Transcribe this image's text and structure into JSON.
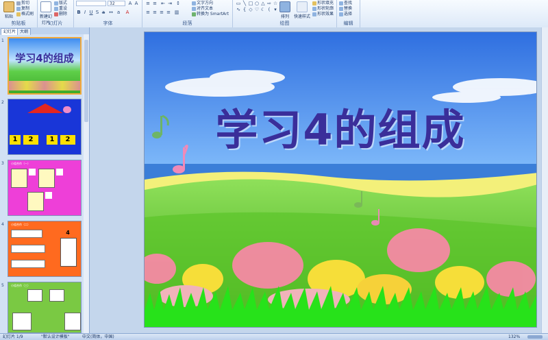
{
  "ribbon": {
    "groups": {
      "clipboard": "剪贴板",
      "slides": "幻灯片",
      "font": "字体",
      "paragraph": "段落",
      "drawing": "绘图",
      "editing": "编辑"
    },
    "paste": "粘贴",
    "cut": "剪切",
    "copy": "复制",
    "format_painter": "格式刷",
    "new_slide": "新建幻灯片",
    "layout": "版式",
    "reset": "重设",
    "delete": "删除",
    "font_size": "32",
    "text_direction": "文字方向",
    "align_text": "对齐文本",
    "convert_smartart": "转换为 SmartArt",
    "arrange": "排列",
    "quick_styles": "快速样式",
    "shape_fill": "形状填充",
    "shape_outline": "形状轮廓",
    "shape_effects": "形状效果",
    "find": "查找",
    "replace": "替换",
    "select": "选择"
  },
  "panel": {
    "tab_slides": "幻灯片",
    "tab_outline": "大纲",
    "thumbnails": [
      {
        "num": "1",
        "title": "学习4的组成"
      },
      {
        "num": "2",
        "cells": [
          "1",
          "2",
          "1",
          "2"
        ]
      },
      {
        "num": "3",
        "caption": "小组合作（一）"
      },
      {
        "num": "4",
        "caption": "小组合作（二）",
        "house_num": "4"
      },
      {
        "num": "5",
        "caption": "小组合作（三）"
      }
    ]
  },
  "slide": {
    "title": "学习4的组成"
  },
  "status": {
    "slide_count": "幻灯片 1/9",
    "theme": "\"默认设计模板\"",
    "language": "中文(简体，中国)",
    "zoom": "132%"
  },
  "colors": {
    "title": "#3a2e9a",
    "sky": "#2f6fe0",
    "grass": "#52c41a",
    "selected_border": "#f2a93b"
  }
}
